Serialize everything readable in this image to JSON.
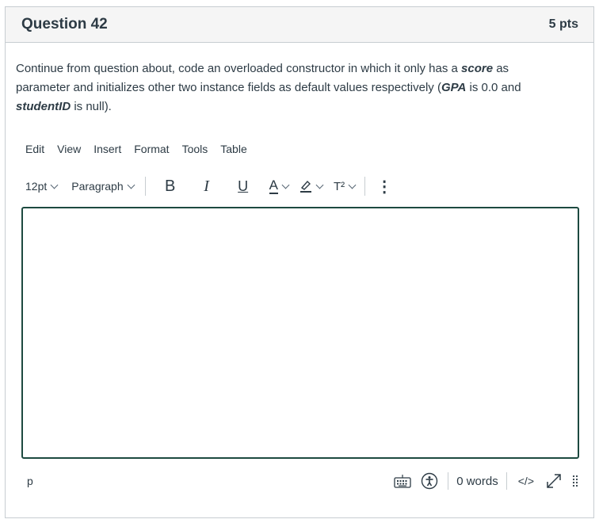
{
  "question": {
    "title": "Question 42",
    "points": "5 pts",
    "text_parts": [
      {
        "t": "Continue from question about, code an overloaded constructor in which it only has a ",
        "em": false
      },
      {
        "t": "score",
        "em": true
      },
      {
        "t": " as parameter and initializes other two instance fields as default values respectively (",
        "em": false
      },
      {
        "t": "GPA",
        "em": true
      },
      {
        "t": " is 0.0 and ",
        "em": false
      },
      {
        "t": "studentID",
        "em": true
      },
      {
        "t": " is null).",
        "em": false
      }
    ]
  },
  "editor": {
    "menus": [
      "Edit",
      "View",
      "Insert",
      "Format",
      "Tools",
      "Table"
    ],
    "font_size": "12pt",
    "block_format": "Paragraph",
    "buttons": {
      "bold": "B",
      "italic": "I",
      "underline": "U",
      "text_color": "A",
      "superscript": "T²",
      "more": "⋮"
    },
    "content": "",
    "status": {
      "path": "p",
      "word_count": "0 words",
      "html_toggle": "</>"
    }
  },
  "colors": {
    "border": "#c7cdd1",
    "editor_border": "#1d4a40",
    "text": "#2d3b45"
  }
}
